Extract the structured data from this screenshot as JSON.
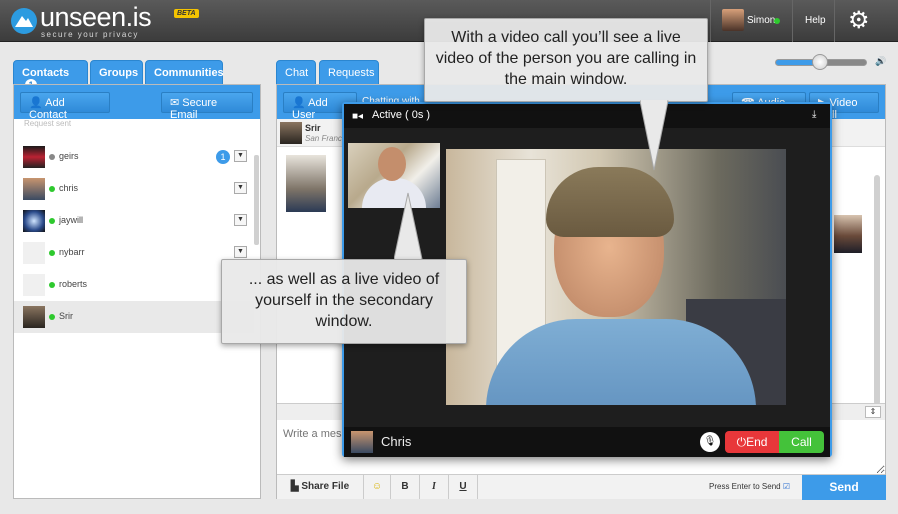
{
  "app": {
    "logo_text": "unseen.is",
    "tagline": "secure your privacy",
    "beta": "BETA"
  },
  "topbar": {
    "user_name": "Simon",
    "help_label": "Help",
    "settings_icon": "gear-icon"
  },
  "left_tabs": [
    {
      "label": "Contacts",
      "count": "1"
    },
    {
      "label": "Groups"
    },
    {
      "label": "Communities"
    }
  ],
  "left_toolbar": {
    "add_contact": "Add Contact",
    "secure_email": "Secure Email"
  },
  "contacts": {
    "section_label": "Request sent",
    "items": [
      {
        "name": "geirs",
        "status": "offline",
        "badge": "1"
      },
      {
        "name": "chris",
        "status": "online"
      },
      {
        "name": "jaywill",
        "status": "online"
      },
      {
        "name": "nybarr",
        "status": "online"
      },
      {
        "name": "roberts",
        "status": "online"
      },
      {
        "name": "Srir",
        "status": "online",
        "selected": true
      }
    ]
  },
  "chat_tabs": [
    {
      "label": "Chat"
    },
    {
      "label": "Requests"
    }
  ],
  "chat_toolbar": {
    "add_user": "Add User",
    "chatting_with": "Chatting with",
    "audio_call": "Audio Call",
    "video_call": "Video Call"
  },
  "chat_header": {
    "name": "Srir",
    "location": "San Francisco"
  },
  "chat_input": {
    "placeholder": "Write a message..."
  },
  "bottom_bar": {
    "share_file": "Share File",
    "bold": "B",
    "italic": "I",
    "underline": "U",
    "press_enter": "Press Enter to Send",
    "send": "Send"
  },
  "volume": {
    "level_percent": 48
  },
  "video_window": {
    "status": "Active ( 0s )",
    "caller_name": "Chris",
    "end_label": "End",
    "call_label": "Call"
  },
  "callouts": {
    "top": "With a video call you’ll see a live video of the person you are calling in the main window.",
    "left": "... as well as a live video of yourself in the secondary window."
  },
  "colors": {
    "accent": "#3d9be9",
    "online": "#2ec92e",
    "end": "#e8373a",
    "call": "#44c23a"
  }
}
